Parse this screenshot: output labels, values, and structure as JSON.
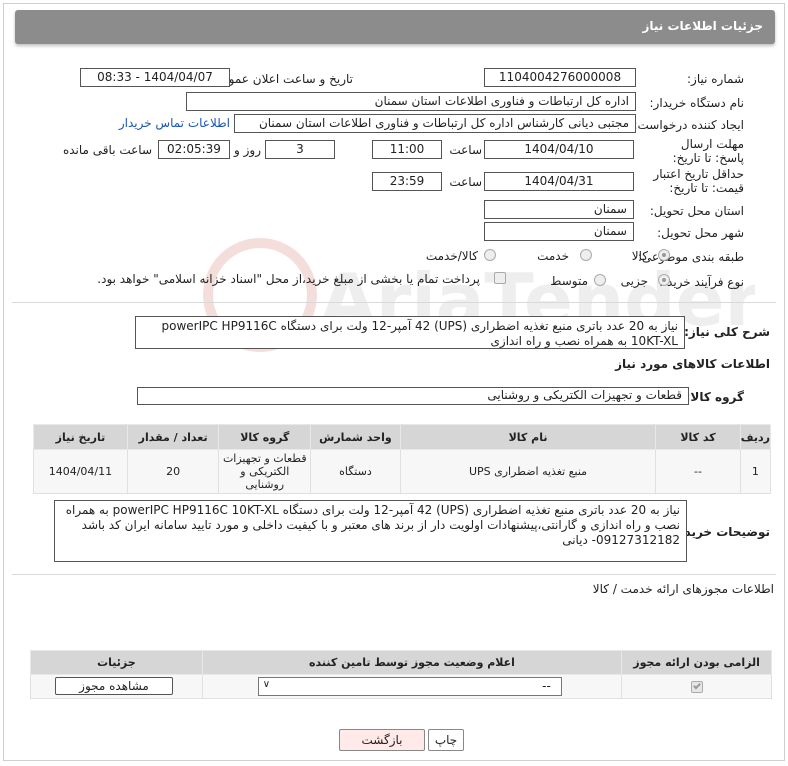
{
  "header": {
    "title": "جزئیات اطلاعات نیاز"
  },
  "fields": {
    "need_number_label": "شماره نیاز:",
    "need_number": "1104004276000008",
    "announce_label": "تاریخ و ساعت اعلان عمومی:",
    "announce_value": "1404/04/07 - 08:33",
    "buyer_org_label": "نام دستگاه خریدار:",
    "buyer_org": "اداره کل ارتباطات و فناوری اطلاعات استان سمنان",
    "creator_label": "ایجاد کننده درخواست:",
    "creator": "مجتبی دیانی کارشناس اداره کل ارتباطات و فناوری اطلاعات استان سمنان",
    "contact_link": "اطلاعات تماس خریدار",
    "deadline_label": "مهلت ارسال پاسخ: تا تاریخ:",
    "deadline_date": "1404/04/10",
    "time_label": "ساعت",
    "deadline_time": "11:00",
    "days_value": "3",
    "days_label": "روز و",
    "remaining_time": "02:05:39",
    "remaining_label": "ساعت باقی مانده",
    "validity_label": "حداقل تاریخ اعتبار قیمت: تا تاریخ:",
    "validity_date": "1404/04/31",
    "validity_time": "23:59",
    "province_label": "استان محل تحویل:",
    "province": "سمنان",
    "city_label": "شهر محل تحویل:",
    "city": "سمنان",
    "category_label": "طبقه بندی موضوعی:",
    "category_options": [
      "کالا",
      "خدمت",
      "کالا/خدمت"
    ],
    "process_label": "نوع فرآیند خرید :",
    "process_options": [
      "جزیی",
      "متوسط"
    ],
    "payment_note": "پرداخت تمام یا بخشی از مبلغ خرید،از محل \"اسناد خزانه اسلامی\" خواهد بود."
  },
  "description": {
    "label": "شرح کلی نیاز:",
    "text": "نیاز به 20 عدد باتری منبع تغذیه اضطراری (UPS) 42 آمپر-12 ولت برای دستگاه powerIPC HP9116C 10KT-XL به همراه نصب و  راه اندازی"
  },
  "goods_section": {
    "title": "اطلاعات کالاهای مورد نیاز",
    "group_label": "گروه کالا:",
    "group_value": "قطعات و تجهیزات الکتریکی و روشنایی"
  },
  "goods_table": {
    "headers": [
      "ردیف",
      "کد کالا",
      "نام کالا",
      "واحد شمارش",
      "گروه کالا",
      "تعداد / مقدار",
      "تاریخ نیاز"
    ],
    "rows": [
      [
        "1",
        "--",
        "منبع تغذیه اضطراری UPS",
        "دستگاه",
        "قطعات و تجهیزات الکتریکی و روشنایی",
        "20",
        "1404/04/11"
      ]
    ]
  },
  "buyer_notes": {
    "label": "توضیحات خریدار:",
    "text": "نیاز به 20 عدد باتری منبع تغذیه اضطراری (UPS) 42 آمپر-12 ولت برای دستگاه powerIPC HP9116C 10KT-XL به همراه نصب و  راه اندازی و گارانتی،پیشنهادات اولویت دار  از برند های معتبر و با کیفیت داخلی و مورد تایید سامانه ایران کد باشد 09127312182- دیانی"
  },
  "permits_section": {
    "title": "اطلاعات مجوزهای ارائه خدمت / کالا",
    "headers": [
      "الزامی بودن ارائه مجوز",
      "اعلام وضعیت مجوز توسط تامین کننده",
      "جزئیات"
    ],
    "select_value": "--",
    "view_button": "مشاهده مجوز"
  },
  "buttons": {
    "print": "چاپ",
    "back": "بازگشت"
  },
  "colors": {
    "header_bg": "#8c8c8c",
    "link": "#1a55b7",
    "table_header": "#d6d6d6"
  }
}
